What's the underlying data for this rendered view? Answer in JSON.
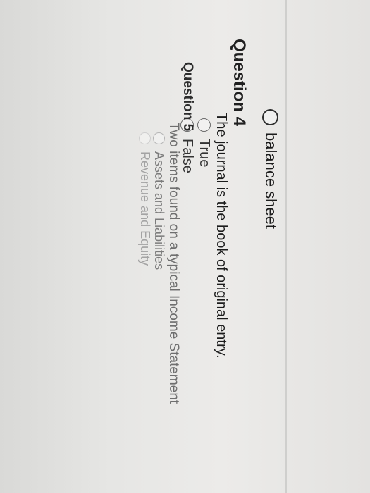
{
  "prev_option": {
    "label": "balance sheet"
  },
  "question4": {
    "title": "Question 4",
    "prompt": "The journal is the book of original entry.",
    "options": [
      {
        "label": "True",
        "selected": false
      },
      {
        "label": "False",
        "selected": false
      }
    ]
  },
  "question5": {
    "title": "Question 5",
    "prompt": "Two items found on a typical Income Statement",
    "options": [
      {
        "label": "Assets and Liabilities",
        "selected": false
      },
      {
        "label": "Revenue and Equity",
        "selected": false
      }
    ]
  }
}
